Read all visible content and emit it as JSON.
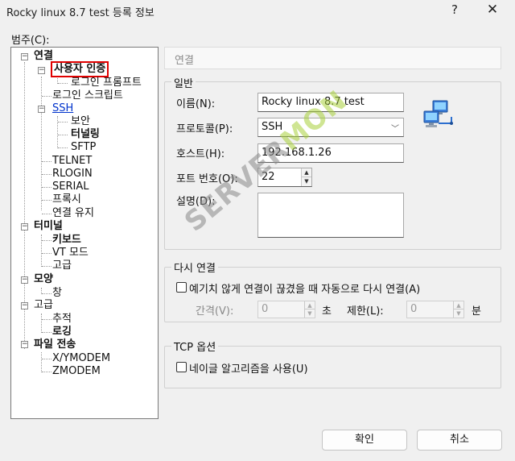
{
  "window": {
    "title": "Rocky linux 8.7 test 등록 정보",
    "help_glyph": "?",
    "close_glyph": "✕"
  },
  "category_label": "범주(C):",
  "tree": {
    "connection": "연결",
    "user_auth": "사용자 인증",
    "login_prompt": "로그인 프롬프트",
    "login_script": "로그인 스크립트",
    "ssh": "SSH",
    "security": "보안",
    "tunneling": "터널링",
    "sftp": "SFTP",
    "telnet": "TELNET",
    "rlogin": "RLOGIN",
    "serial": "SERIAL",
    "proxy": "프록시",
    "keepalive": "연결 유지",
    "terminal": "터미널",
    "keyboard": "키보드",
    "vt_mode": "VT 모드",
    "advanced_term": "고급",
    "appearance": "모양",
    "window": "창",
    "advanced": "고급",
    "trace": "추적",
    "logging": "로깅",
    "file_transfer": "파일 전송",
    "xymodem": "X/YMODEM",
    "zmodem": "ZMODEM"
  },
  "panel": {
    "header": "연결",
    "general": {
      "title": "일반",
      "name_label": "이름(N):",
      "name_value": "Rocky linux 8.7 test",
      "protocol_label": "프로토콜(P):",
      "protocol_value": "SSH",
      "host_label": "호스트(H):",
      "host_value": "192.168.1.26",
      "port_label": "포트 번호(O):",
      "port_value": "22",
      "desc_label": "설명(D):",
      "desc_value": ""
    },
    "reconnect": {
      "title": "다시 연결",
      "auto_label": "예기치 않게 연결이 끊겼을 때 자동으로 다시 연결(A)",
      "interval_label": "간격(V):",
      "interval_value": "0",
      "interval_unit": "초",
      "limit_label": "제한(L):",
      "limit_value": "0",
      "limit_unit": "분"
    },
    "tcp": {
      "title": "TCP 옵션",
      "nagle_label": "네이글 알고리즘을 사용(U)"
    }
  },
  "buttons": {
    "ok": "확인",
    "cancel": "취소"
  },
  "watermark": {
    "part1": "SERVER",
    "part2": "MON"
  },
  "colors": {
    "selection_outline": "#e00000",
    "link": "#0033cc",
    "watermark_green": "#a9d13b"
  }
}
